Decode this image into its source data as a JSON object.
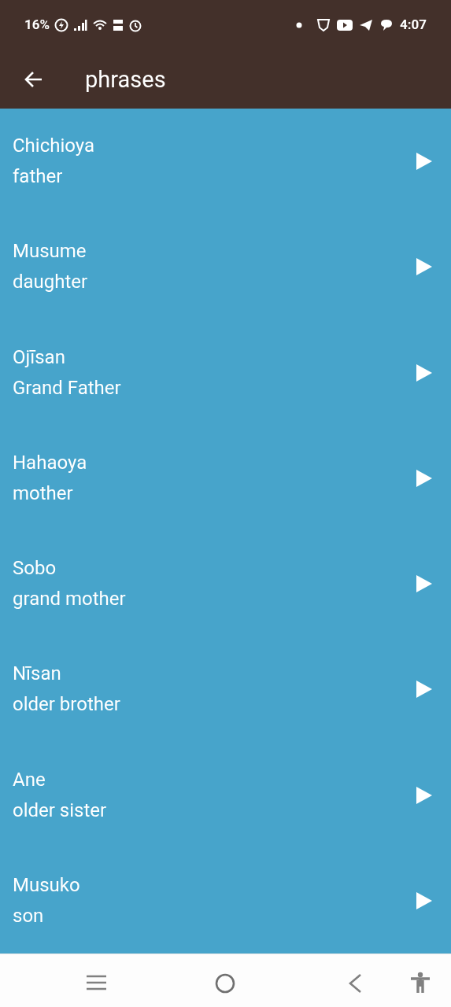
{
  "status_bar": {
    "battery": "16%",
    "time": "4:07"
  },
  "app_bar": {
    "title": "phrases"
  },
  "phrases": [
    {
      "word": "Chichioya",
      "meaning": "father"
    },
    {
      "word": "Musume",
      "meaning": "daughter"
    },
    {
      "word": "Ojīsan",
      "meaning": "Grand Father"
    },
    {
      "word": "Hahaoya",
      "meaning": "mother"
    },
    {
      "word": "Sobo",
      "meaning": "grand mother"
    },
    {
      "word": "Nīsan",
      "meaning": "older brother"
    },
    {
      "word": "Ane",
      "meaning": "older sister"
    },
    {
      "word": "Musuko",
      "meaning": "son"
    }
  ]
}
